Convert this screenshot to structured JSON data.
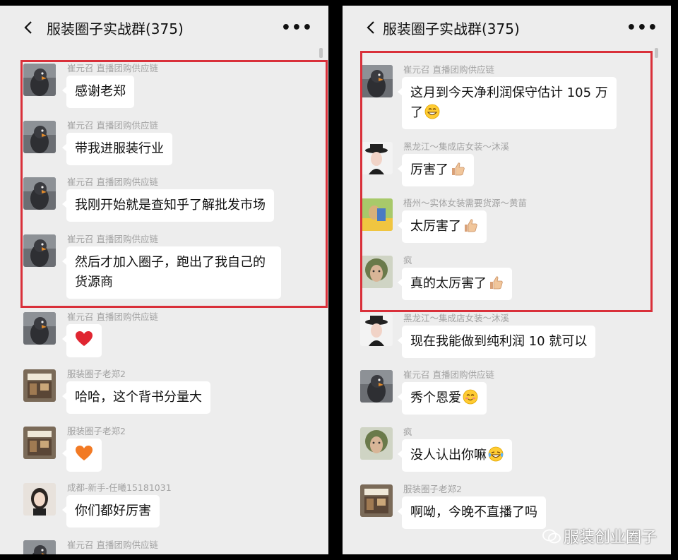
{
  "left": {
    "title": "服装圈子实战群(375)",
    "messages": [
      {
        "sender": "崔元召 直播团购供应链",
        "text": "感谢老郑"
      },
      {
        "sender": "崔元召 直播团购供应链",
        "text": "带我进服装行业"
      },
      {
        "sender": "崔元召 直播团购供应链",
        "text": "我刚开始就是查知乎了解批发市场"
      },
      {
        "sender": "崔元召 直播团购供应链",
        "text": "然后才加入圈子，跑出了我自己的货源商"
      },
      {
        "sender": "崔元召 直播团购供应链",
        "text": ""
      },
      {
        "sender": "服装圈子老郑2",
        "text": "哈哈，这个背书分量大"
      },
      {
        "sender": "服装圈子老郑2",
        "text": ""
      },
      {
        "sender": "成都-新手-任曦15181031",
        "text": "你们都好厉害"
      },
      {
        "sender": "崔元召 直播团购供应链",
        "text": ""
      }
    ]
  },
  "right": {
    "title": "服装圈子实战群(375)",
    "messages": [
      {
        "sender": "崔元召 直播团购供应链",
        "text": "这月到今天净利润保守估计 105 万了"
      },
      {
        "sender": "黑龙江～集成店女装～沐溪",
        "text": "厉害了"
      },
      {
        "sender": "梧州～实体女装需要货源～黄苗",
        "text": "太厉害了"
      },
      {
        "sender": "疯",
        "text": "真的太厉害了"
      },
      {
        "sender": "黑龙江～集成店女装～沐溪",
        "text": "现在我能做到纯利润 10 就可以"
      },
      {
        "sender": "崔元召 直播团购供应链",
        "text": "秀个恩爱"
      },
      {
        "sender": "疯",
        "text": "没人认出你嘛"
      },
      {
        "sender": "服装圈子老郑2",
        "text": "啊呦，今晚不直播了吗"
      }
    ]
  },
  "watermark": "服装创业圈子",
  "colors": {
    "highlight": "#d9303a",
    "background": "#ededed",
    "bubble": "#ffffff"
  }
}
